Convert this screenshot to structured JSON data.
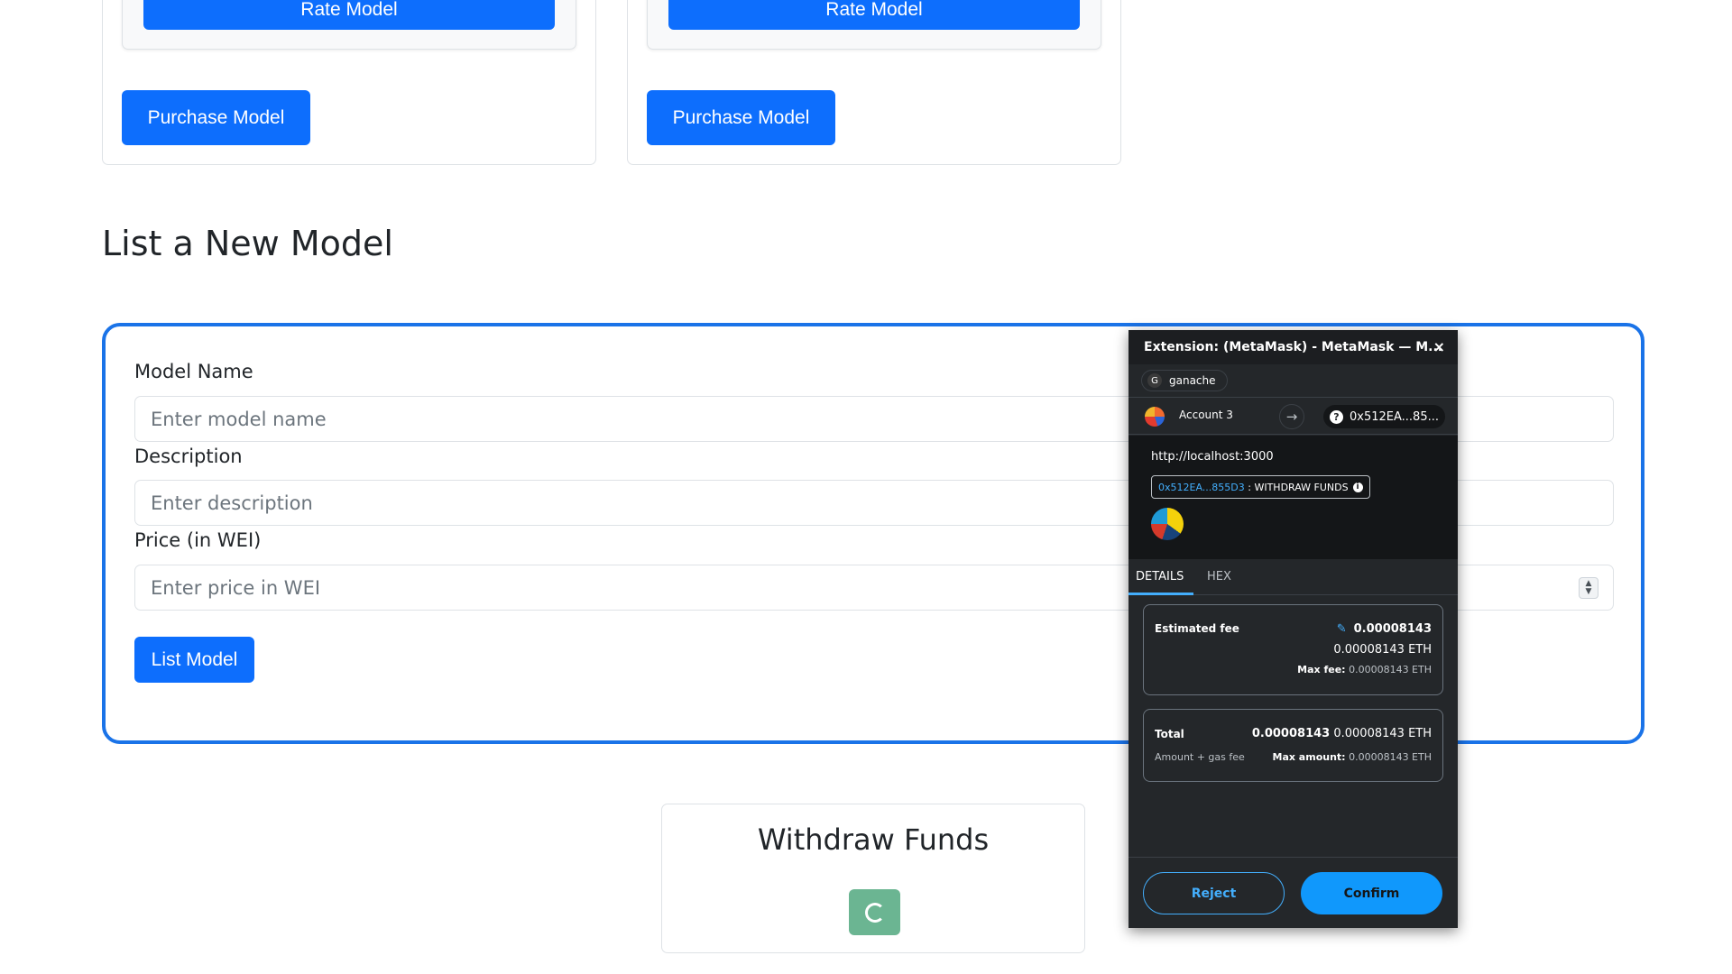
{
  "cards": [
    {
      "rate_label": "Rate Model",
      "purchase_label": "Purchase Model"
    },
    {
      "rate_label": "Rate Model",
      "purchase_label": "Purchase Model"
    }
  ],
  "section_title": "List a New Model",
  "form": {
    "name_label": "Model Name",
    "name_placeholder": "Enter model name",
    "description_label": "Description",
    "description_placeholder": "Enter description",
    "price_label": "Price (in WEI)",
    "price_placeholder": "Enter price in WEI",
    "submit_label": "List Model"
  },
  "withdraw": {
    "title": "Withdraw Funds"
  },
  "metamask": {
    "window_title": "Extension: (MetaMask) - MetaMask — M...",
    "close_glyph": "×",
    "network_initial": "G",
    "network_name": "ganache",
    "network_color": "#3a3a3a",
    "account_name": "Account 3",
    "arrow_glyph": "→",
    "to_address": "0x512EA...85...",
    "origin": "http://localhost:3000",
    "contract_address": "0x512EA...855D3",
    "method_sep": " : ",
    "method_name": "WITHDRAW FUNDS",
    "tabs": [
      "DETAILS",
      "HEX"
    ],
    "estimated_fee_label": "Estimated fee",
    "estimated_fee_value": "0.00008143",
    "estimated_fee_eth": "0.00008143 ETH",
    "max_fee_label": "Max fee:",
    "max_fee_value": "0.00008143 ETH",
    "total_label": "Total",
    "total_bold": "0.00008143",
    "total_eth": "0.00008143 ETH",
    "total_sub": "Amount + gas fee",
    "max_amount_label": "Max amount:",
    "max_amount_value": "0.00008143 ETH",
    "reject_label": "Reject",
    "confirm_label": "Confirm",
    "accent_color": "#43aefc"
  }
}
